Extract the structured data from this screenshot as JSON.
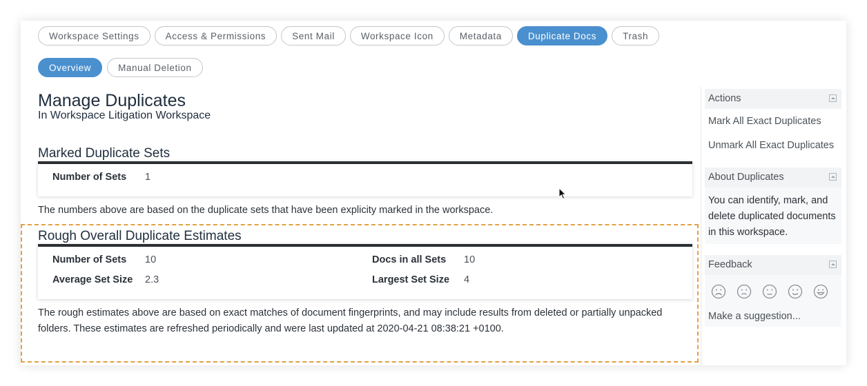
{
  "tabs": [
    {
      "label": "Workspace Settings",
      "active": false
    },
    {
      "label": "Access & Permissions",
      "active": false
    },
    {
      "label": "Sent Mail",
      "active": false
    },
    {
      "label": "Workspace Icon",
      "active": false
    },
    {
      "label": "Metadata",
      "active": false
    },
    {
      "label": "Duplicate Docs",
      "active": true
    },
    {
      "label": "Trash",
      "active": false
    }
  ],
  "subtabs": [
    {
      "label": "Overview",
      "active": true
    },
    {
      "label": "Manual Deletion",
      "active": false
    }
  ],
  "main": {
    "title": "Manage Duplicates",
    "subtitle": "In Workspace Litigation Workspace",
    "marked": {
      "title": "Marked Duplicate Sets",
      "number_of_sets_label": "Number of Sets",
      "number_of_sets_value": "1",
      "note": "The numbers above are based on the duplicate sets that have been explicity marked in the workspace."
    },
    "rough": {
      "title": "Rough Overall Duplicate Estimates",
      "number_of_sets_label": "Number of Sets",
      "number_of_sets_value": "10",
      "docs_in_all_sets_label": "Docs in all Sets",
      "docs_in_all_sets_value": "10",
      "average_set_size_label": "Average Set Size",
      "average_set_size_value": "2.3",
      "largest_set_size_label": "Largest Set Size",
      "largest_set_size_value": "4",
      "note": "The rough estimates above are based on exact matches of document fingerprints, and may include results from deleted or partially unpacked folders. These estimates are refreshed periodically and were last updated at 2020-04-21 08:38:21 +0100."
    }
  },
  "sidebar": {
    "actions": {
      "title": "Actions",
      "items": [
        "Mark All Exact Duplicates",
        "Unmark All Exact Duplicates"
      ]
    },
    "about": {
      "title": "About Duplicates",
      "text": "You can identify, mark, and delete duplicated documents in this workspace."
    },
    "feedback": {
      "title": "Feedback",
      "faces": [
        "very-sad-face-icon",
        "sad-face-icon",
        "neutral-face-icon",
        "happy-face-icon",
        "very-happy-face-icon"
      ],
      "suggestion": "Make a suggestion..."
    }
  },
  "colors": {
    "accent": "#4a90cf",
    "highlight_border": "#e3a043",
    "section_rule": "#2b2f33"
  }
}
